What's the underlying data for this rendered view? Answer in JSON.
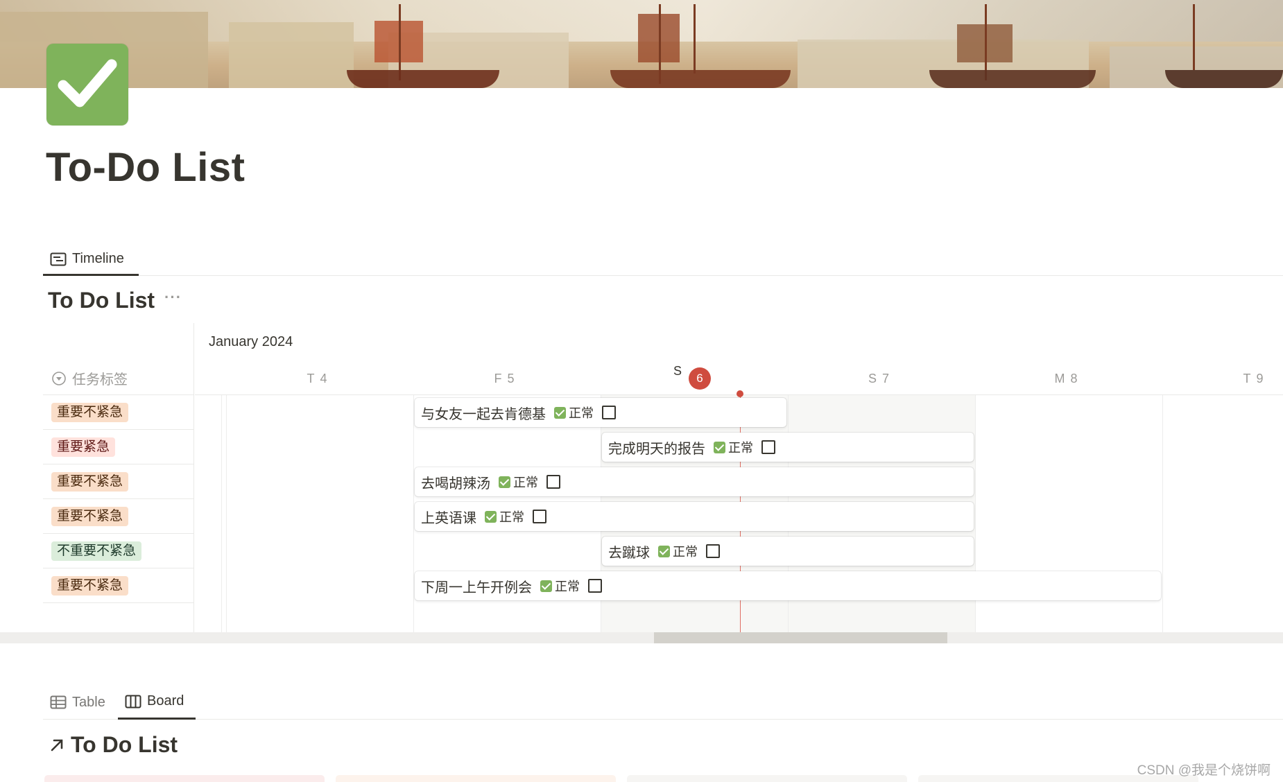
{
  "page": {
    "title": "To-Do List",
    "icon": "check-mark-button-icon",
    "cover": "venice-harbor-painting"
  },
  "views_top": [
    {
      "label": "Timeline",
      "icon": "timeline-icon",
      "active": true
    }
  ],
  "timeline": {
    "db_title": "To Do List",
    "more": "···",
    "month": "January 2024",
    "group_header": "任务标签",
    "days": [
      {
        "dow": "T",
        "num": "4"
      },
      {
        "dow": "F",
        "num": "5"
      },
      {
        "dow": "S",
        "num": "6",
        "today": true
      },
      {
        "dow": "S",
        "num": "7"
      },
      {
        "dow": "M",
        "num": "8"
      },
      {
        "dow": "T",
        "num": "9"
      }
    ],
    "rows": [
      {
        "tag": "重要不紧急",
        "task": "与女友一起去肯德基",
        "status": "正常",
        "start": "2024-01-05",
        "end": "2024-01-06"
      },
      {
        "tag": "重要紧急",
        "task": "完成明天的报告",
        "status": "正常",
        "start": "2024-01-06",
        "end": "2024-01-07"
      },
      {
        "tag": "重要不紧急",
        "task": "去喝胡辣汤",
        "status": "正常",
        "start": "2024-01-05",
        "end": "2024-01-07"
      },
      {
        "tag": "重要不紧急",
        "task": "上英语课",
        "status": "正常",
        "start": "2024-01-05",
        "end": "2024-01-07"
      },
      {
        "tag": "不重要不紧急",
        "task": "去蹴球",
        "status": "正常",
        "start": "2024-01-06",
        "end": "2024-01-07"
      },
      {
        "tag": "重要不紧急",
        "task": "下周一上午开例会",
        "status": "正常",
        "start": "2024-01-05",
        "end": "2024-01-08"
      }
    ]
  },
  "views_bottom": [
    {
      "label": "Table",
      "icon": "table-icon",
      "active": false
    },
    {
      "label": "Board",
      "icon": "board-icon",
      "active": true
    }
  ],
  "board": {
    "db_title": "To Do List",
    "link_icon": "arrow-up-right-icon"
  },
  "watermark": "CSDN @我是个烧饼啊",
  "colors": {
    "tag_orange_bg": "#fadec9",
    "tag_orange_fg": "#49290e",
    "tag_red_bg": "#ffe2dd",
    "tag_red_fg": "#5d1715",
    "tag_green_bg": "#dbeddb",
    "tag_green_fg": "#1c3829",
    "today": "#cf4c3f",
    "check_green": "#7fb35b"
  }
}
